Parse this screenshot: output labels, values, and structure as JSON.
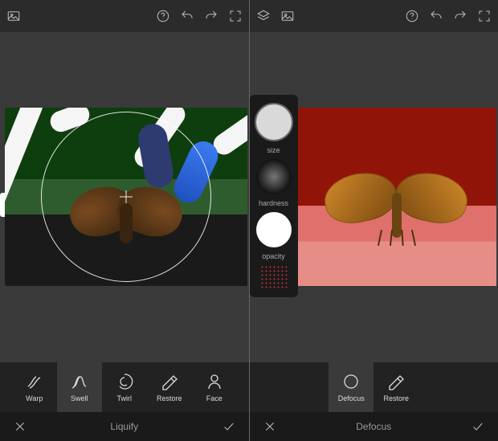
{
  "left": {
    "mode_label": "Liquify",
    "tools": [
      {
        "id": "warp",
        "label": "Warp"
      },
      {
        "id": "swell",
        "label": "Swell"
      },
      {
        "id": "twirl",
        "label": "Twirl"
      },
      {
        "id": "restore",
        "label": "Restore"
      },
      {
        "id": "face",
        "label": "Face"
      }
    ],
    "active_tool": "swell"
  },
  "right": {
    "mode_label": "Defocus",
    "tools": [
      {
        "id": "defocus",
        "label": "Defocus"
      },
      {
        "id": "restore",
        "label": "Restore"
      }
    ],
    "active_tool": "defocus",
    "brush_panel": {
      "size_label": "size",
      "hardness_label": "hardness",
      "opacity_label": "opacity"
    }
  },
  "topbar_icons": [
    "help",
    "undo",
    "redo",
    "fullscreen"
  ],
  "topbar_left_icons_right_pane": [
    "layers",
    "image"
  ],
  "topbar_left_icons_left_pane": [
    "image"
  ]
}
